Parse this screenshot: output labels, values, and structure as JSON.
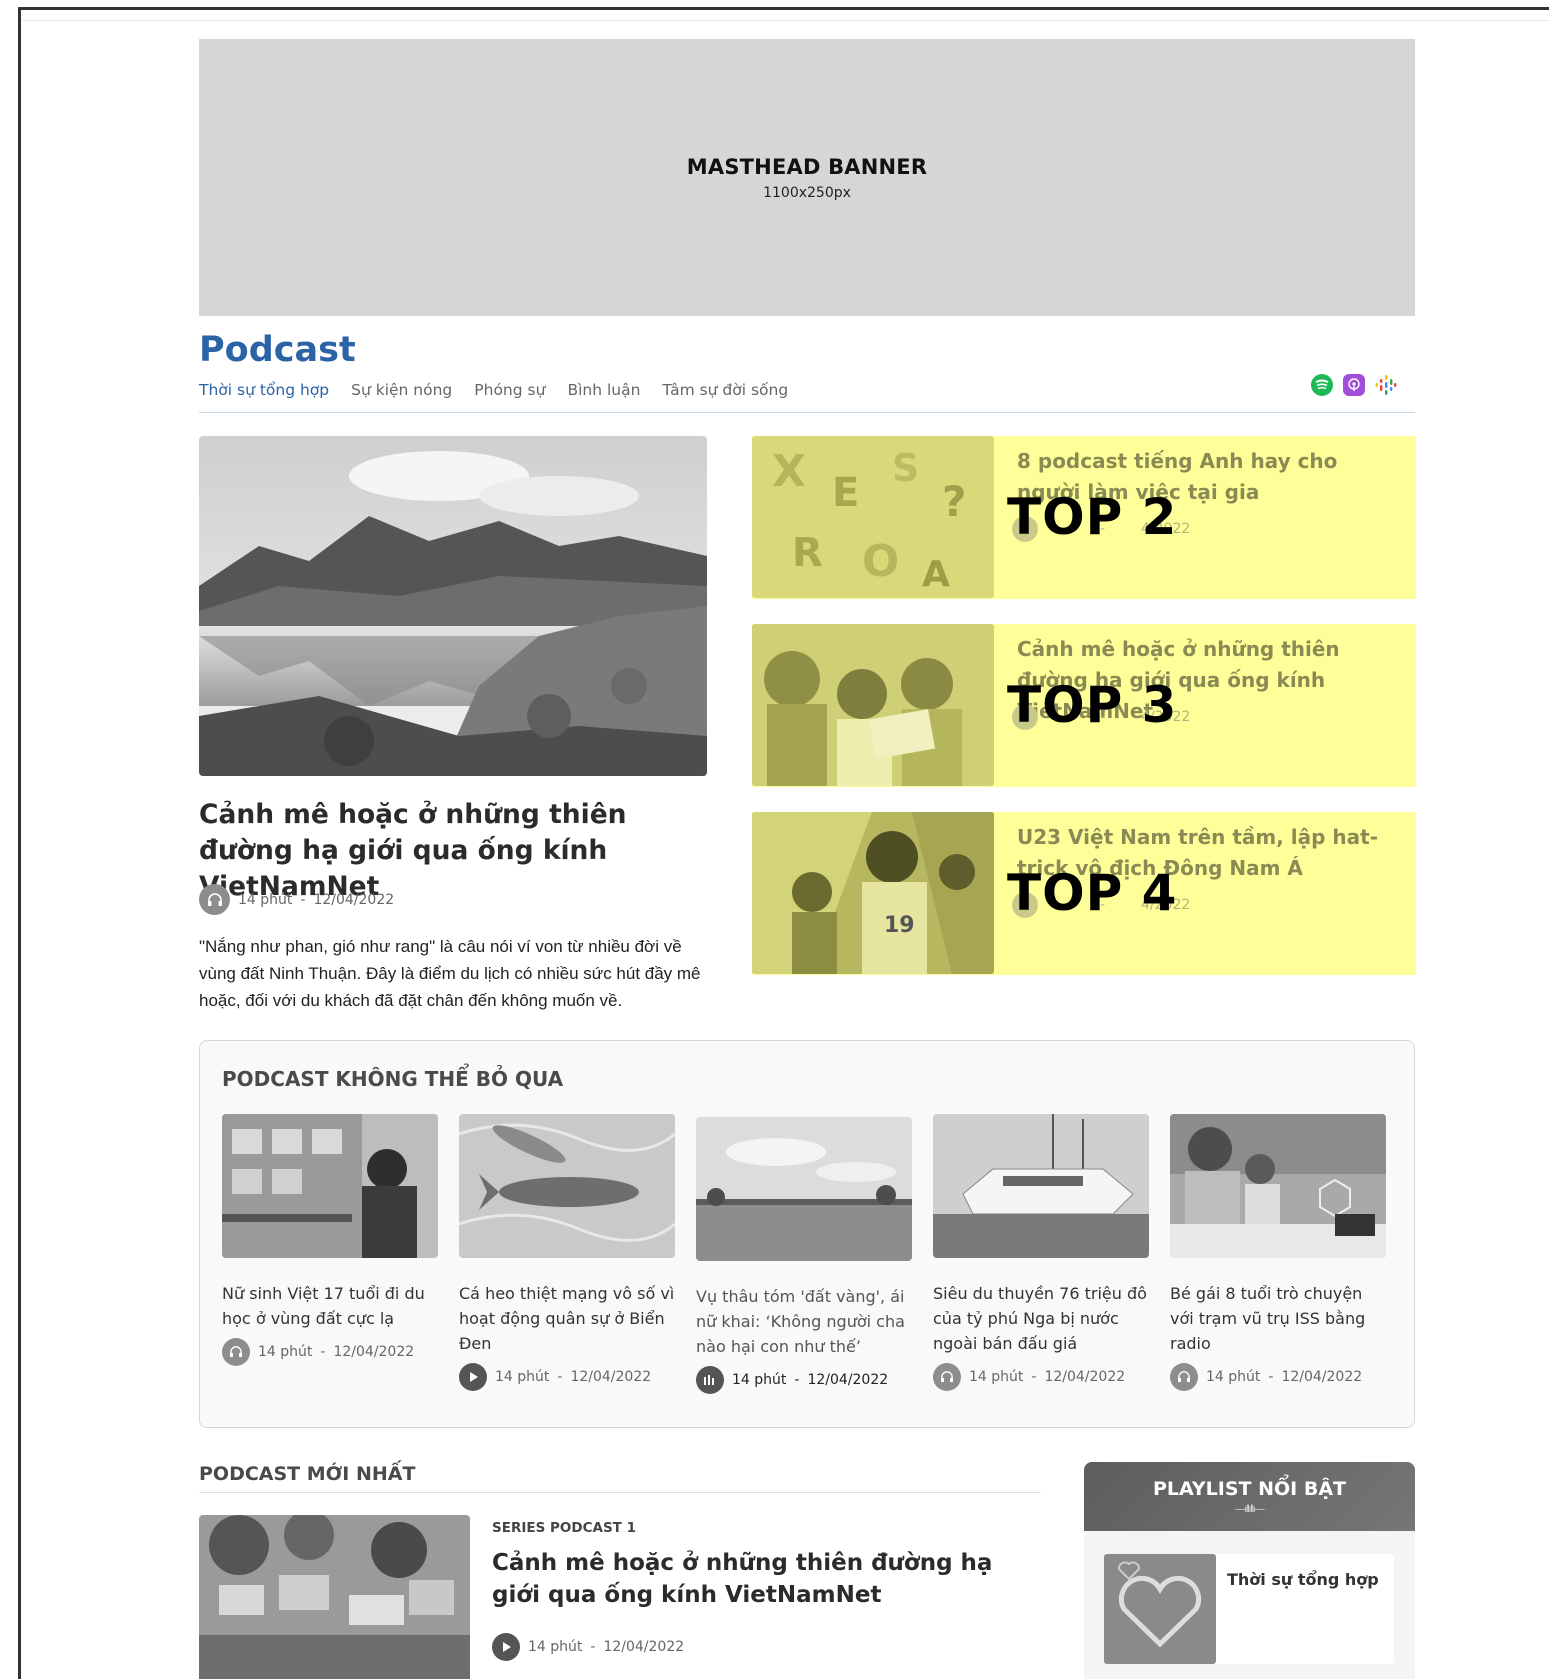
{
  "masthead": {
    "title": "MASTHEAD BANNER",
    "size": "1100x250px"
  },
  "section": {
    "title": "Podcast"
  },
  "nav": [
    "Thời sự tổng hợp",
    "Sự kiện nóng",
    "Phóng sự",
    "Bình luận",
    "Tâm sự đời sống"
  ],
  "platforms": [
    "spotify-icon",
    "apple-podcasts-icon",
    "google-podcasts-icon"
  ],
  "hero": {
    "title": "Cảnh mê hoặc ở những thiên đường hạ giới qua ống kính VietNamNet",
    "duration": "14 phút",
    "date": "12/04/2022",
    "description": "\"Nắng như phan, gió như rang\" là câu nói ví von từ nhiều đời về vùng đất Ninh Thuận. Đây là điểm du lịch có nhiều sức hút đầy mê hoặc, đối với du khách đã đặt chân đến không muốn về."
  },
  "top_cards": [
    {
      "title": "8 podcast tiếng Anh hay cho người làm việc tại gia",
      "meta_left": "t -",
      "date": "4/2022",
      "badge": "TOP 2"
    },
    {
      "title": "Cảnh mê hoặc ở những thiên đường hạ giới qua ống kính VietNamNet",
      "meta_left": "t -",
      "date": "4/2022",
      "badge": "TOP 3"
    },
    {
      "title": "U23 Việt Nam trên tầm, lập hat-trick vô địch Đông Nam Á",
      "meta_left": "t -",
      "date": "4/2022",
      "badge": "TOP 4"
    }
  ],
  "must_listen": {
    "title": "PODCAST KHÔNG THỂ BỎ QUA",
    "items": [
      {
        "title": "Nữ sinh Việt 17 tuổi đi du học ở vùng đất cực lạ",
        "duration": "14 phút",
        "date": "12/04/2022"
      },
      {
        "title": "Cá heo thiệt mạng vô số vì hoạt động quân sự ở Biển Đen",
        "duration": "14 phút",
        "date": "12/04/2022"
      },
      {
        "title": "Vụ thâu tóm 'đất vàng', ái nữ khai: ‘Không người cha nào hại con như thế’",
        "duration": "14 phút",
        "date": "12/04/2022"
      },
      {
        "title": "Siêu du thuyền 76 triệu đô của tỷ phú Nga bị nước ngoài bán đấu giá",
        "duration": "14 phút",
        "date": "12/04/2022"
      },
      {
        "title": "Bé gái 8 tuổi trò chuyện với trạm vũ trụ ISS bằng radio",
        "duration": "14 phút",
        "date": "12/04/2022"
      }
    ]
  },
  "newest": {
    "title": "PODCAST MỚI NHẤT",
    "series": "SERIES PODCAST 1",
    "headline": "Cảnh mê hoặc ở những thiên đường hạ giới qua ống kính VietNamNet",
    "duration": "14 phút",
    "date": "12/04/2022"
  },
  "playlist": {
    "title": "PLAYLIST NỔI BẬT",
    "item": "Thời sự tổng hợp"
  },
  "separator": "-"
}
